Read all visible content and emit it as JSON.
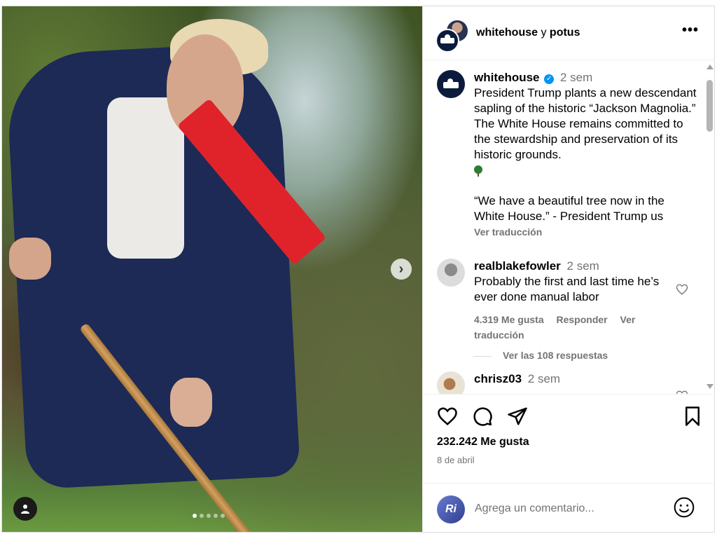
{
  "header": {
    "account_primary": "whitehouse",
    "connector": "y",
    "account_secondary": "potus",
    "more_label": "•••"
  },
  "caption": {
    "username": "whitehouse",
    "verified_mark": "✓",
    "time": "2 sem",
    "line1": "President Trump plants a new descendant sapling of the historic “Jackson Magnolia.” The White House remains committed to the stewardship and preservation of its historic grounds.",
    "quote": "“We have a beautiful tree now in the White House.” - President Trump us",
    "translate": "Ver traducción"
  },
  "comments": [
    {
      "username": "realblakefowler",
      "time": "2 sem",
      "text": "Probably the first and last time he’s ever done manual labor",
      "likes": "4.319 Me gusta",
      "reply": "Responder",
      "translate": "Ver traducción",
      "view_replies": "Ver las 108 respuestas"
    },
    {
      "username": "chrisz03",
      "time": "2 sem"
    }
  ],
  "post": {
    "likes": "232.242 Me gusta",
    "date": "8 de abril"
  },
  "comment_box": {
    "avatar_text": "Ri",
    "placeholder": "Agrega un comentario..."
  },
  "carousel": {
    "next_icon": "›"
  },
  "colors": {
    "secondary_text": "#737373",
    "verified": "#0095f6",
    "divider": "#efefef"
  }
}
